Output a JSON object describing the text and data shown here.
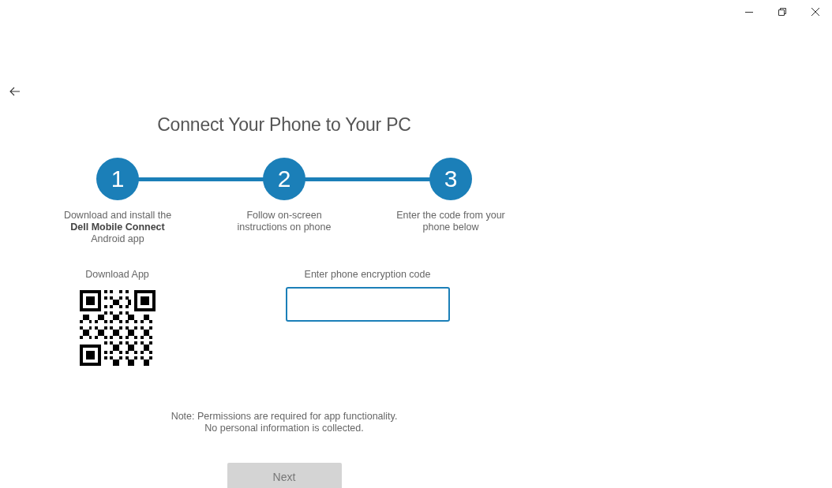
{
  "window": {
    "controls": [
      {
        "kind": "minimize"
      },
      {
        "kind": "restore"
      },
      {
        "kind": "close"
      }
    ]
  },
  "title": "Connect Your Phone to Your PC",
  "steps": [
    {
      "number": "1",
      "text": "Download and install the\n**Dell Mobile Connect**\nAndroid app"
    },
    {
      "number": "2",
      "text": "Follow on-screen\ninstructions on phone"
    },
    {
      "number": "3",
      "text": "Enter the code from your\nphone below"
    }
  ],
  "download": {
    "label": "Download App"
  },
  "code": {
    "label": "Enter phone encryption code",
    "focused": true
  },
  "note": "Note: Permissions are required for app functionality.\nNo personal information is collected.",
  "next_button": {
    "label": "Next",
    "disabled": true
  }
}
